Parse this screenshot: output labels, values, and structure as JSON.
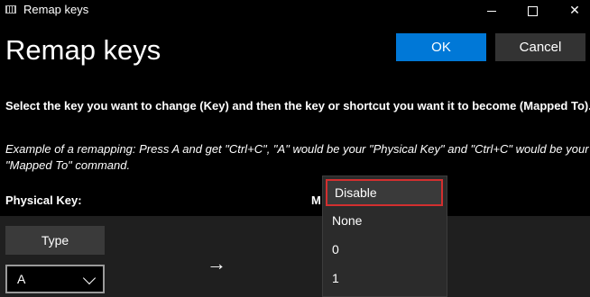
{
  "window": {
    "title": "Remap keys",
    "app_icon": "keyboard-icon",
    "controls": {
      "minimize_icon": "minimize-icon",
      "maximize_icon": "maximize-icon",
      "close_glyph": "✕"
    }
  },
  "header": {
    "title": "Remap keys",
    "ok_label": "OK",
    "cancel_label": "Cancel",
    "ok_color": "#0078d7"
  },
  "instructions": {
    "main": "Select the key you want to change (Key) and then the key or shortcut you want it to become (Mapped To).",
    "example": "Example of a remapping: Press A and get \"Ctrl+C\", \"A\" would be your \"Physical Key\" and \"Ctrl+C\" would be your \"Mapped To\" command."
  },
  "columns": {
    "physical_key": "Physical Key:",
    "mapped_to_partial": "M"
  },
  "row": {
    "type_label": "Type",
    "physical_key_value": "A",
    "arrow_glyph": "→"
  },
  "dropdown": {
    "items": [
      "Disable",
      "None",
      "0",
      "1"
    ],
    "selected": "Disable",
    "highlight_color": "#d32f2f"
  }
}
